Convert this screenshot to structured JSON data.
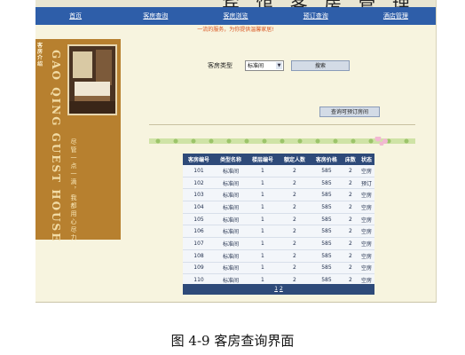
{
  "banner": {
    "title": "宾 馆 客 房 管 理"
  },
  "nav": [
    "首页",
    "客房查询",
    "客房浏览",
    "预订查询",
    "酒店管理"
  ],
  "notice": "一流的服务，为你提供温馨家居!",
  "sidebar": {
    "label": "客房介绍",
    "vertical_title": "GAO QING GUEST HOUSE",
    "slogan": "尽管一点一滴，我都用心尽力"
  },
  "search": {
    "label": "客房类型",
    "selected": "标准间",
    "button": "搜索"
  },
  "booked_button": "查询可预订房间",
  "table": {
    "headers": [
      "客房编号",
      "类型名称",
      "楼层编号",
      "额定人数",
      "客房价格",
      "床数",
      "状态"
    ],
    "rows": [
      [
        "101",
        "标准间",
        "1",
        "2",
        "585",
        "2",
        "空房"
      ],
      [
        "102",
        "标准间",
        "1",
        "2",
        "585",
        "2",
        "预订"
      ],
      [
        "103",
        "标准间",
        "1",
        "2",
        "585",
        "2",
        "空房"
      ],
      [
        "104",
        "标准间",
        "1",
        "2",
        "585",
        "2",
        "空房"
      ],
      [
        "105",
        "标准间",
        "1",
        "2",
        "585",
        "2",
        "空房"
      ],
      [
        "106",
        "标准间",
        "1",
        "2",
        "585",
        "2",
        "空房"
      ],
      [
        "107",
        "标准间",
        "1",
        "2",
        "585",
        "2",
        "空房"
      ],
      [
        "108",
        "标准间",
        "1",
        "2",
        "585",
        "2",
        "空房"
      ],
      [
        "109",
        "标准间",
        "1",
        "2",
        "585",
        "2",
        "空房"
      ],
      [
        "110",
        "标准间",
        "1",
        "2",
        "585",
        "2",
        "空房"
      ]
    ]
  },
  "pager": [
    "1",
    "2"
  ],
  "caption": "图 4-9  客房查询界面",
  "colors": {
    "nav": "#2e5ea9",
    "sidebar": "#b7802f",
    "table_header": "#2e4a79",
    "notice": "#d9531e"
  }
}
